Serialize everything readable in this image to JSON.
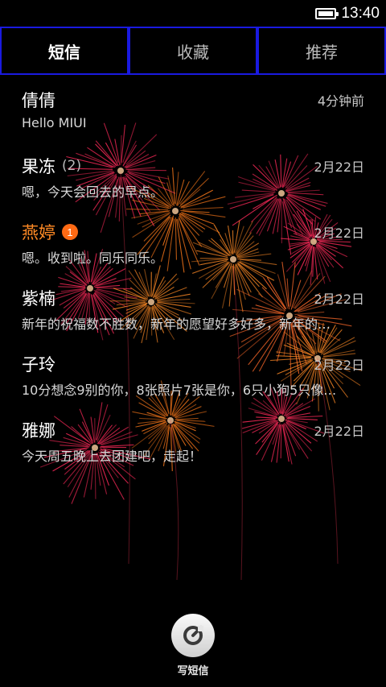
{
  "status_bar": {
    "time": "13:40",
    "battery_icon": "battery-icon"
  },
  "tabs": [
    {
      "label": "短信",
      "active": true
    },
    {
      "label": "收藏",
      "active": false
    },
    {
      "label": "推荐",
      "active": false
    }
  ],
  "conversations": [
    {
      "name": "倩倩",
      "count": "",
      "badge": "",
      "date": "4分钟前",
      "preview": "Hello MIUI"
    },
    {
      "name": "果冻",
      "count": "(2)",
      "badge": "",
      "date": "2月22日",
      "preview": "嗯，今天会回去的早点。"
    },
    {
      "name": "燕婷",
      "count": "",
      "badge": "1",
      "date": "2月22日",
      "preview": "嗯。收到啦。同乐同乐。"
    },
    {
      "name": "紫楠",
      "count": "",
      "badge": "",
      "date": "2月22日",
      "preview": "新年的祝福数不胜数，新年的愿望好多好多，新年的…"
    },
    {
      "name": "子玲",
      "count": "",
      "badge": "",
      "date": "2月22日",
      "preview": "10分想念9别的你，8张照片7张是你，6只小狗5只像…"
    },
    {
      "name": "雅娜",
      "count": "",
      "badge": "",
      "date": "2月22日",
      "preview": "今天周五晚上去团建吧，走起！"
    }
  ],
  "compose": {
    "label": "写短信",
    "icon": "compose-icon"
  },
  "colors": {
    "tab_border": "#1a1ae0",
    "unread_accent": "#ff8a25",
    "badge": "#ff6a14",
    "background": "#000000"
  }
}
